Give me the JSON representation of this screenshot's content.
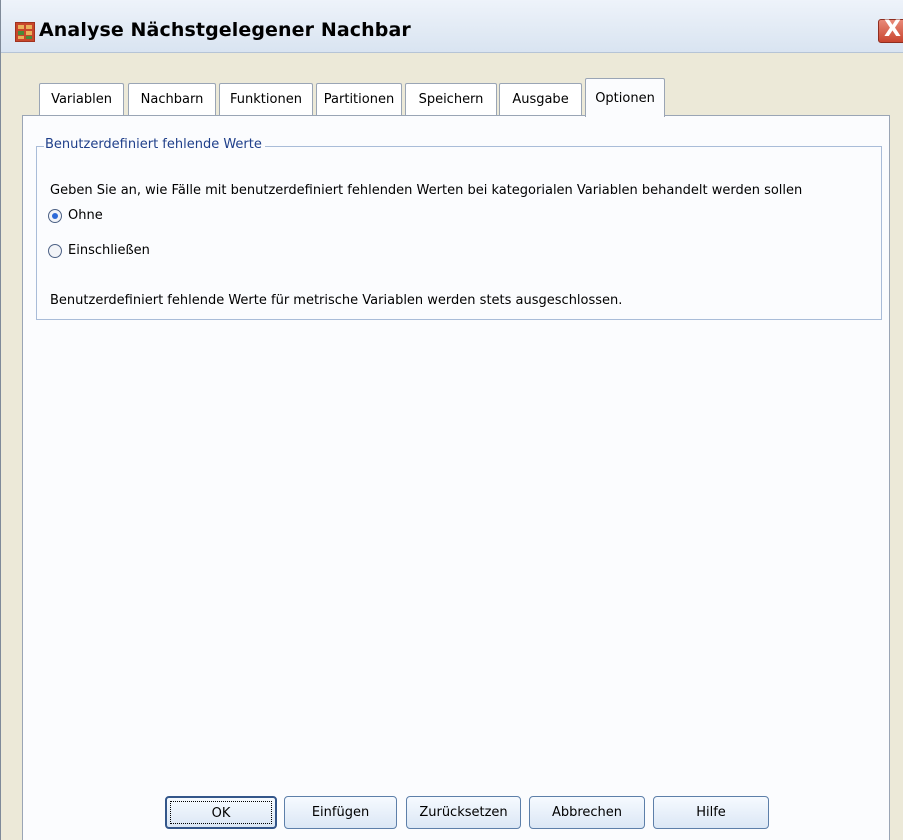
{
  "window": {
    "title": "Analyse Nächstgelegener Nachbar",
    "close_label": "X"
  },
  "tabs": [
    {
      "label": "Variablen",
      "active": false
    },
    {
      "label": "Nachbarn",
      "active": false
    },
    {
      "label": "Funktionen",
      "active": false
    },
    {
      "label": "Partitionen",
      "active": false
    },
    {
      "label": "Speichern",
      "active": false
    },
    {
      "label": "Ausgabe",
      "active": false
    },
    {
      "label": "Optionen",
      "active": true
    }
  ],
  "group": {
    "legend": "Benutzerdefiniert fehlende Werte",
    "description": "Geben Sie an, wie Fälle mit benutzerdefiniert fehlenden Werten bei kategorialen Variablen behandelt werden sollen",
    "options": [
      {
        "label": "Ohne",
        "selected": true
      },
      {
        "label": "Einschließen",
        "selected": false
      }
    ],
    "note": "Benutzerdefiniert fehlende Werte für metrische Variablen werden stets ausgeschlossen."
  },
  "buttons": {
    "ok": "OK",
    "paste": "Einfügen",
    "reset": "Zurücksetzen",
    "cancel": "Abbrechen",
    "help": "Hilfe"
  },
  "colors": {
    "accent": "#2d6ad8",
    "legend_text": "#1f3f8a",
    "close": "#c9452f"
  }
}
